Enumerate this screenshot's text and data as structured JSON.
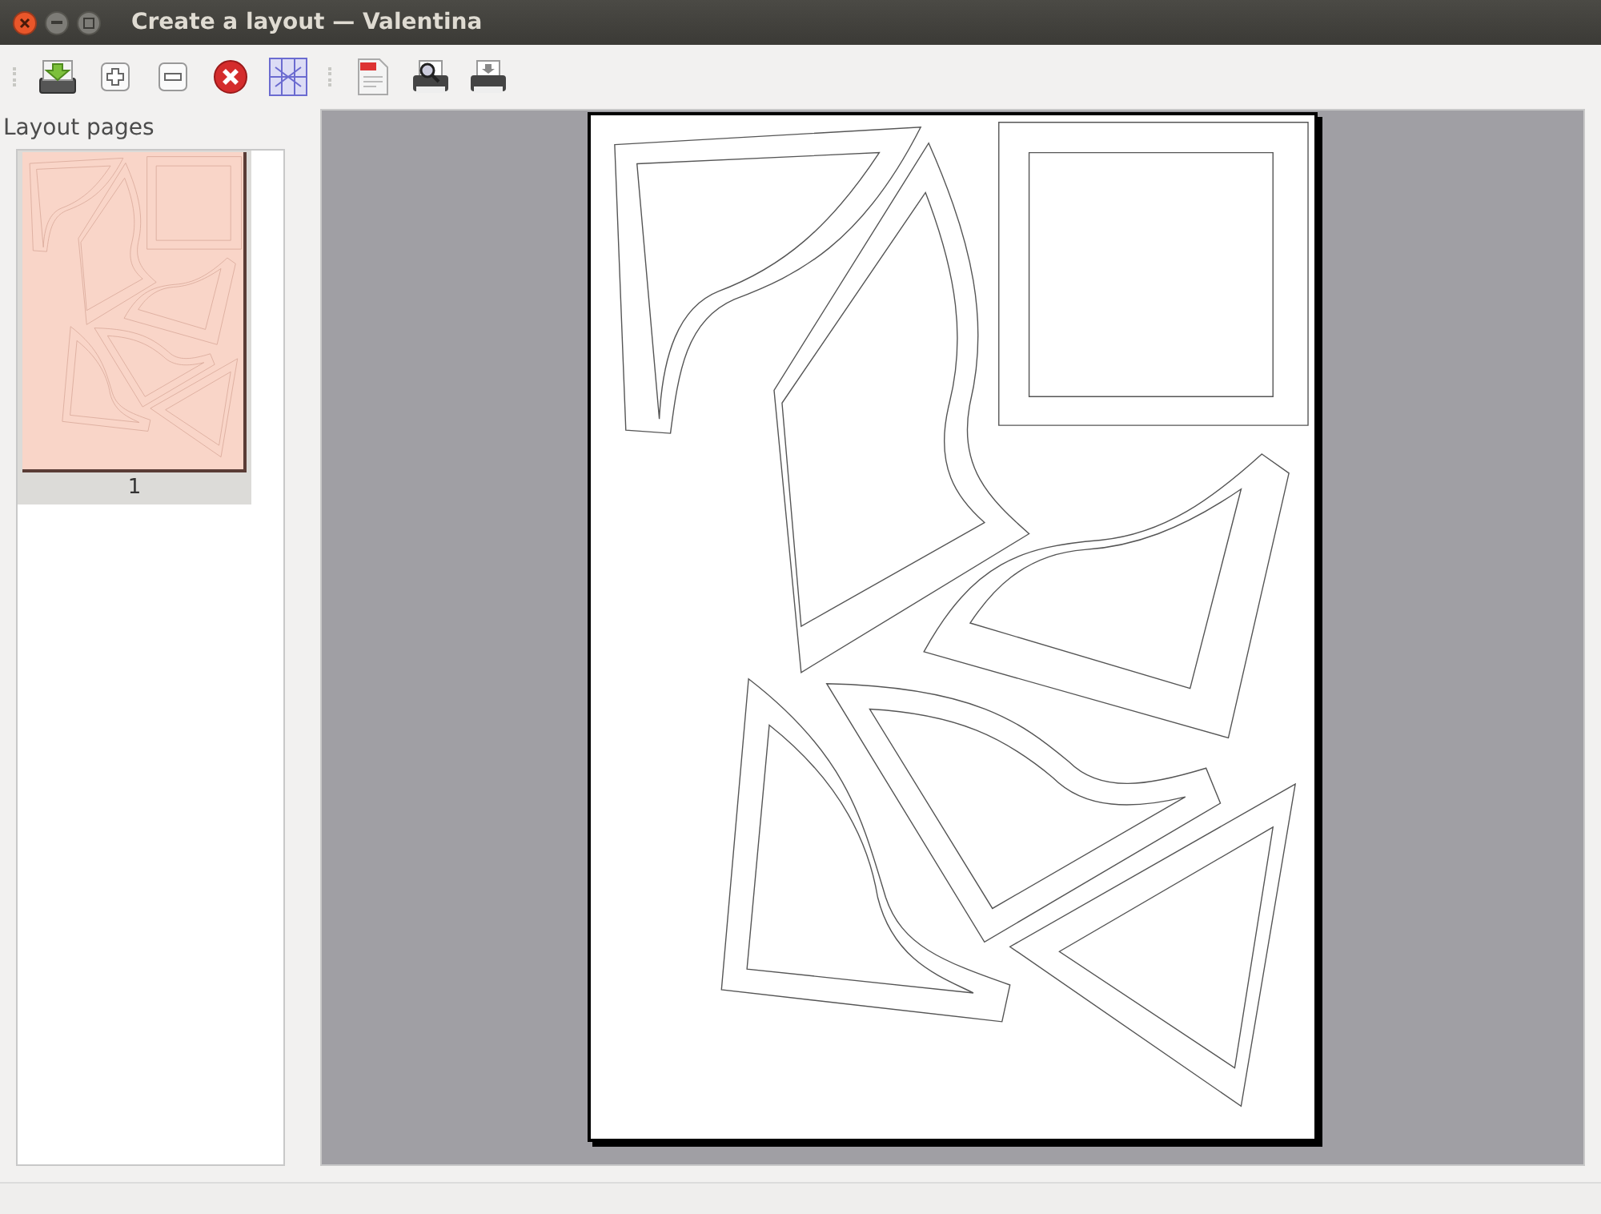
{
  "window": {
    "title": "Create a layout — Valentina"
  },
  "sidebar": {
    "title": "Layout pages",
    "pages": [
      {
        "label": "1",
        "selected": true
      }
    ]
  }
}
